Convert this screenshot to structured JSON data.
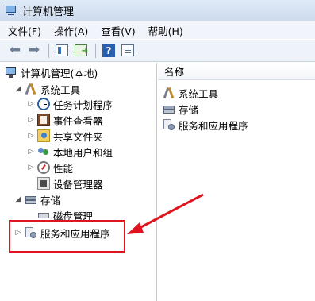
{
  "window": {
    "title": "计算机管理"
  },
  "menu": {
    "items": [
      "文件(F)",
      "操作(A)",
      "查看(V)",
      "帮助(H)"
    ]
  },
  "tree": {
    "root": "计算机管理(本地)",
    "system_tools": "系统工具",
    "task_scheduler": "任务计划程序",
    "event_viewer": "事件查看器",
    "shared_folders": "共享文件夹",
    "local_users": "本地用户和组",
    "performance": "性能",
    "device_manager": "设备管理器",
    "storage": "存储",
    "disk_management": "磁盘管理",
    "services_apps": "服务和应用程序"
  },
  "list": {
    "header": "名称",
    "items": [
      "系统工具",
      "存储",
      "服务和应用程序"
    ]
  },
  "annotation": {
    "color": "#e0141e"
  }
}
